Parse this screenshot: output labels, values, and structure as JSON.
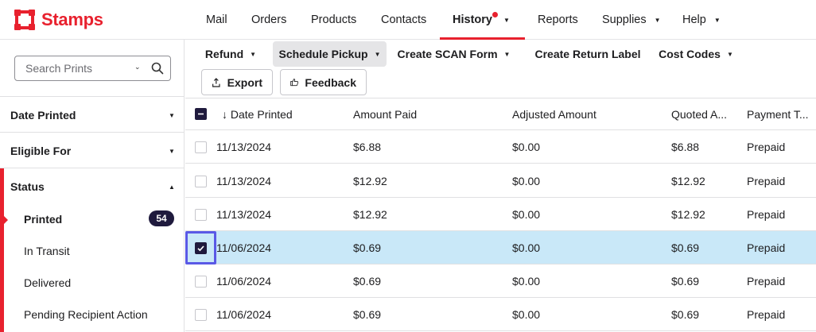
{
  "brand": {
    "name": "Stamps",
    "color": "#e8212e"
  },
  "nav": {
    "items": [
      {
        "label": "Mail",
        "caret": false
      },
      {
        "label": "Orders",
        "caret": false
      },
      {
        "label": "Products",
        "caret": false
      },
      {
        "label": "Contacts",
        "caret": false
      },
      {
        "label": "History",
        "caret": true,
        "active": true,
        "notification": true
      },
      {
        "label": "Reports",
        "caret": false
      },
      {
        "label": "Supplies",
        "caret": true
      },
      {
        "label": "Help",
        "caret": true
      }
    ]
  },
  "sidebar": {
    "search_placeholder": "Search Prints",
    "sections": [
      {
        "label": "Date Printed",
        "expanded": false
      },
      {
        "label": "Eligible For",
        "expanded": false
      },
      {
        "label": "Status",
        "expanded": true
      }
    ],
    "status_items": [
      {
        "label": "Printed",
        "count": "54",
        "selected": true
      },
      {
        "label": "In Transit"
      },
      {
        "label": "Delivered"
      },
      {
        "label": "Pending Recipient Action"
      }
    ]
  },
  "toolbar": {
    "refund": "Refund",
    "schedule_pickup": "Schedule Pickup",
    "create_scan_form": "Create SCAN Form",
    "create_return_label": "Create Return Label",
    "cost_codes": "Cost Codes",
    "export": "Export",
    "feedback": "Feedback"
  },
  "table": {
    "sort_indicator": "↓",
    "columns": [
      "Date Printed",
      "Amount Paid",
      "Adjusted Amount",
      "Quoted A...",
      "Payment T..."
    ],
    "rows": [
      {
        "date": "11/13/2024",
        "amount_paid": "$6.88",
        "adjusted": "$0.00",
        "quoted": "$6.88",
        "payment": "Prepaid",
        "checked": false
      },
      {
        "date": "11/13/2024",
        "amount_paid": "$12.92",
        "adjusted": "$0.00",
        "quoted": "$12.92",
        "payment": "Prepaid",
        "checked": false
      },
      {
        "date": "11/13/2024",
        "amount_paid": "$12.92",
        "adjusted": "$0.00",
        "quoted": "$12.92",
        "payment": "Prepaid",
        "checked": false
      },
      {
        "date": "11/06/2024",
        "amount_paid": "$0.69",
        "adjusted": "$0.00",
        "quoted": "$0.69",
        "payment": "Prepaid",
        "checked": true
      },
      {
        "date": "11/06/2024",
        "amount_paid": "$0.69",
        "adjusted": "$0.00",
        "quoted": "$0.69",
        "payment": "Prepaid",
        "checked": false
      },
      {
        "date": "11/06/2024",
        "amount_paid": "$0.69",
        "adjusted": "$0.00",
        "quoted": "$0.69",
        "payment": "Prepaid",
        "checked": false
      }
    ]
  }
}
